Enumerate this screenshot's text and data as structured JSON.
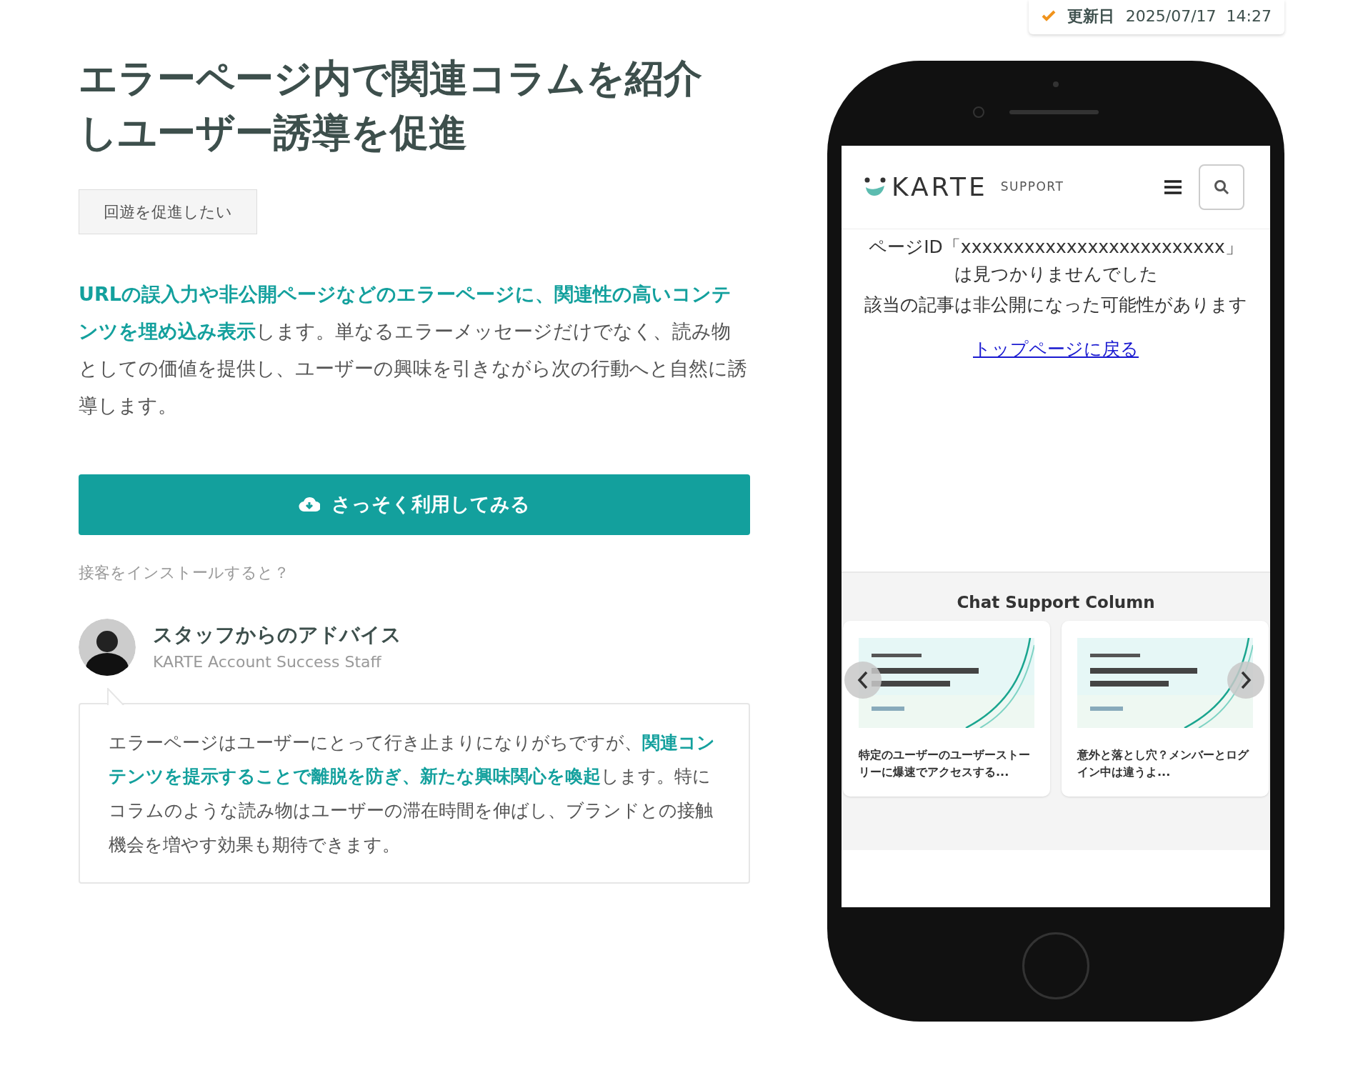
{
  "update_badge": {
    "label": "更新日",
    "date": "2025/07/17  14:27"
  },
  "title": "エラーページ内で関連コラムを紹介しユーザー誘導を促進",
  "tag": "回遊を促進したい",
  "description": "**URLの誤入力や非公開ページなどのエラーページに、関連性の高いコンテンツを埋め込み表示**します。単なるエラーメッセージだけでなく、読み物としての価値を提供し、ユーザーの興味を引きながら次の行動へと自然に誘導します。",
  "cta_button": "さっそく利用してみる",
  "install_note": "接客をインストールすると？",
  "advice": {
    "heading": "スタッフからのアドバイス",
    "role": "KARTE Account Success Staff",
    "body": "エラーページはユーザーにとって行き止まりになりがちですが、**関連コンテンツを提示することで離脱を防ぎ、新たな興味関心を喚起**します。特にコラムのような読み物はユーザーの滞在時間を伸ばし、ブランドとの接触機会を増やす効果も期待できます。"
  },
  "phone": {
    "logo": "KARTE",
    "logo_sub": "SUPPORT",
    "error_lines": [
      "ページID「xxxxxxxxxxxxxxxxxxxxxxxxx」は見つかりませんでした",
      "該当の記事は非公開になった可能性があります"
    ],
    "link": "トップページに戻る",
    "section_title": "Chat Support Column",
    "articles": [
      {
        "kind": "picture",
        "title": "特定のユーザーのユーザーストーリーに爆速でアクセスする..."
      },
      {
        "kind": "picture",
        "title": "意外と落とし穴？メンバーとログイン中は違うよ..."
      }
    ]
  }
}
